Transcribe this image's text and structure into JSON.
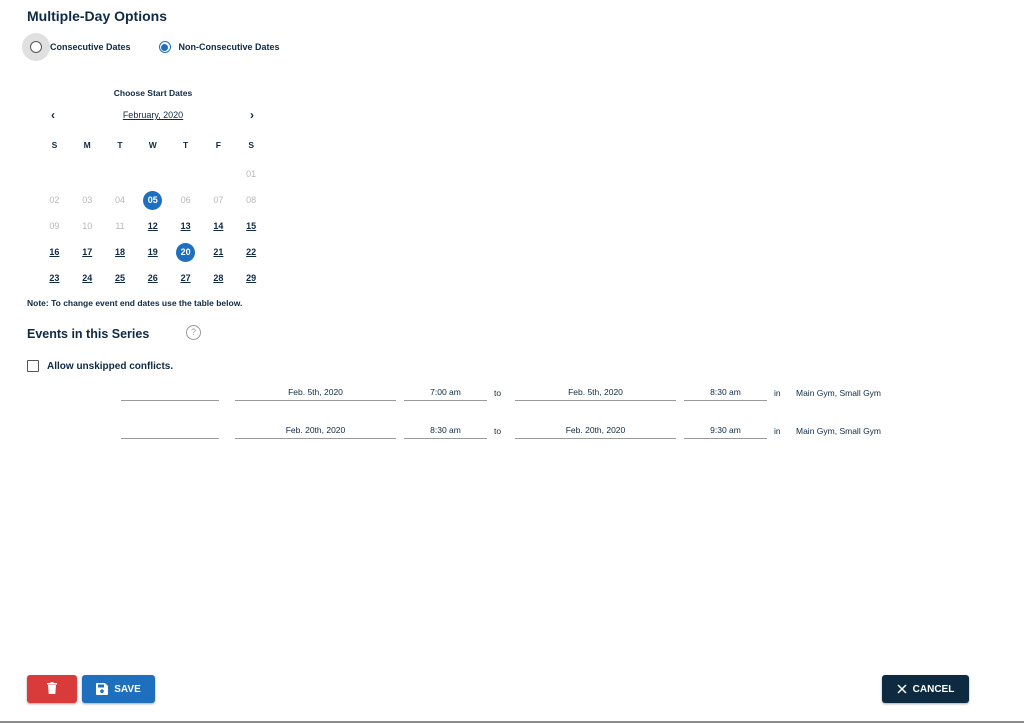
{
  "header": {
    "title": "Multiple-Day Options"
  },
  "date_mode": {
    "options": [
      {
        "label": "Consecutive Dates",
        "selected": false
      },
      {
        "label": "Non-Consecutive Dates",
        "selected": true
      }
    ]
  },
  "calendar": {
    "title": "Choose Start Dates",
    "month_label": "February, 2020",
    "prev_icon": "chevron-left-icon",
    "next_icon": "chevron-right-icon",
    "weekdays": [
      "S",
      "M",
      "T",
      "W",
      "T",
      "F",
      "S"
    ],
    "leading_blanks": 6,
    "days": [
      {
        "d": "01",
        "state": "disabled"
      },
      {
        "d": "02",
        "state": "disabled"
      },
      {
        "d": "03",
        "state": "disabled"
      },
      {
        "d": "04",
        "state": "disabled"
      },
      {
        "d": "05",
        "state": "selected"
      },
      {
        "d": "06",
        "state": "disabled"
      },
      {
        "d": "07",
        "state": "disabled"
      },
      {
        "d": "08",
        "state": "disabled"
      },
      {
        "d": "09",
        "state": "disabled"
      },
      {
        "d": "10",
        "state": "disabled"
      },
      {
        "d": "11",
        "state": "disabled"
      },
      {
        "d": "12",
        "state": "enabled"
      },
      {
        "d": "13",
        "state": "enabled"
      },
      {
        "d": "14",
        "state": "enabled"
      },
      {
        "d": "15",
        "state": "enabled"
      },
      {
        "d": "16",
        "state": "enabled"
      },
      {
        "d": "17",
        "state": "enabled"
      },
      {
        "d": "18",
        "state": "enabled"
      },
      {
        "d": "19",
        "state": "enabled"
      },
      {
        "d": "20",
        "state": "selected"
      },
      {
        "d": "21",
        "state": "enabled"
      },
      {
        "d": "22",
        "state": "enabled"
      },
      {
        "d": "23",
        "state": "enabled"
      },
      {
        "d": "24",
        "state": "enabled"
      },
      {
        "d": "25",
        "state": "enabled"
      },
      {
        "d": "26",
        "state": "enabled"
      },
      {
        "d": "27",
        "state": "enabled"
      },
      {
        "d": "28",
        "state": "enabled"
      },
      {
        "d": "29",
        "state": "enabled"
      }
    ]
  },
  "note": "Note: To change event end dates use the table below.",
  "events": {
    "title": "Events in this Series",
    "help_icon": "help-circle-icon",
    "help_glyph": "?",
    "allow_conflicts_label": "Allow unskipped conflicts.",
    "allow_conflicts_checked": false,
    "to_label": "to",
    "in_label": "in",
    "rows": [
      {
        "name": "",
        "start_date": "Feb. 5th, 2020",
        "start_time": "7:00 am",
        "end_date": "Feb. 5th, 2020",
        "end_time": "8:30 am",
        "location": "Main Gym, Small Gym"
      },
      {
        "name": "",
        "start_date": "Feb. 20th, 2020",
        "start_time": "8:30 am",
        "end_date": "Feb. 20th, 2020",
        "end_time": "9:30 am",
        "location": "Main Gym, Small Gym"
      }
    ]
  },
  "footer": {
    "delete_icon": "trash-icon",
    "save_label": "SAVE",
    "save_icon": "floppy-disk-icon",
    "cancel_label": "CANCEL",
    "cancel_icon": "close-icon"
  },
  "colors": {
    "primary": "#1f6fbf",
    "danger": "#d93a3a",
    "dark": "#0d2a40",
    "text": "#0f2a44"
  }
}
